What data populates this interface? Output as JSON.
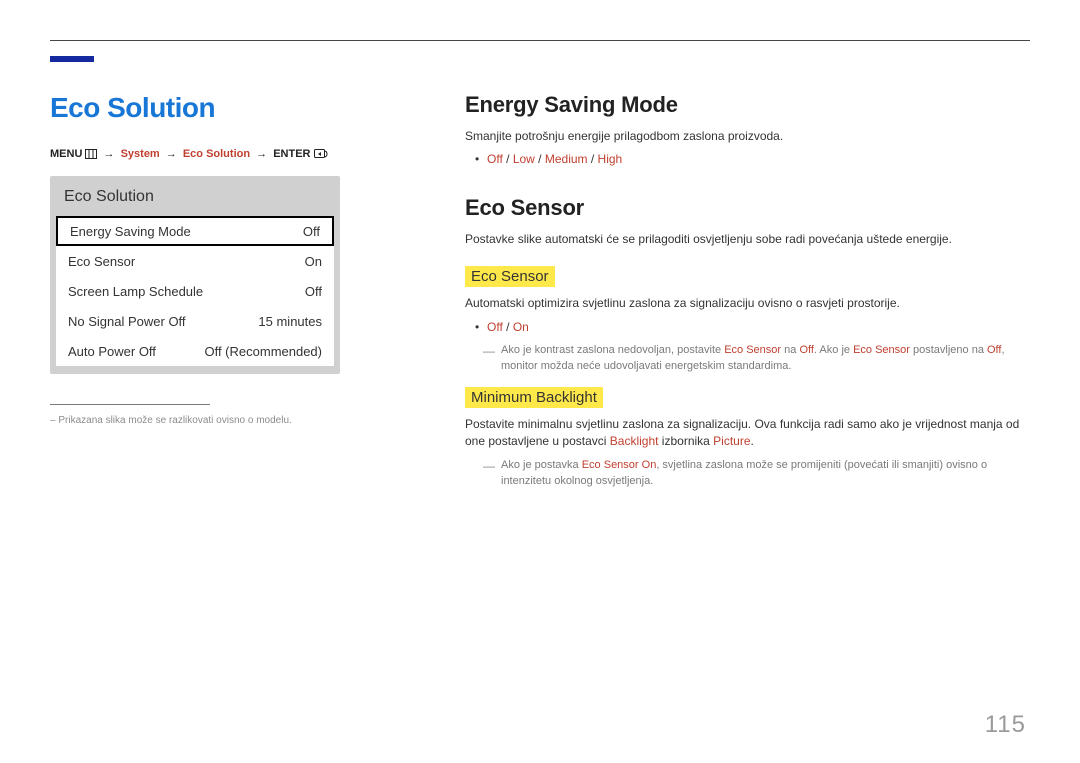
{
  "page_number": "115",
  "left": {
    "title": "Eco Solution",
    "breadcrumb": {
      "prefix": "MENU",
      "system": "System",
      "eco": "Eco Solution",
      "enter": "ENTER"
    },
    "menu": {
      "title": "Eco Solution",
      "rows": [
        {
          "label": "Energy Saving Mode",
          "value": "Off"
        },
        {
          "label": "Eco Sensor",
          "value": "On"
        },
        {
          "label": "Screen Lamp Schedule",
          "value": "Off"
        },
        {
          "label": "No Signal Power Off",
          "value": "15 minutes"
        },
        {
          "label": "Auto Power Off",
          "value": "Off (Recommended)"
        }
      ]
    },
    "note": "Prikazana slika može se razlikovati ovisno o modelu."
  },
  "right": {
    "energy_saving": {
      "heading": "Energy Saving Mode",
      "desc": "Smanjite potrošnju energije prilagodbom zaslona proizvoda.",
      "opts": {
        "off": "Off",
        "low": "Low",
        "medium": "Medium",
        "high": "High"
      }
    },
    "eco_sensor": {
      "heading": "Eco Sensor",
      "desc": "Postavke slike automatski će se prilagoditi osvjetljenju sobe radi povećanja uštede energije.",
      "sub1": {
        "title": "Eco Sensor",
        "desc": "Automatski optimizira svjetlinu zaslona za signalizaciju ovisno o rasvjeti prostorije.",
        "opts": {
          "off": "Off",
          "on": "On"
        },
        "note_pre": "Ako je kontrast zaslona nedovoljan, postavite ",
        "note_eco": "Eco Sensor",
        "note_mid1": " na ",
        "note_off": "Off",
        "note_mid2": ". Ako je ",
        "note_eco2": "Eco Sensor",
        "note_mid3": " postavljeno na ",
        "note_off2": "Off",
        "note_post": ", monitor možda neće udovoljavati energetskim standardima."
      },
      "sub2": {
        "title": "Minimum Backlight",
        "desc_pre": "Postavite minimalnu svjetlinu zaslona za signalizaciju. Ova funkcija radi samo ako je vrijednost manja od one postavljene u postavci ",
        "backlight": "Backlight",
        "desc_mid": " izbornika ",
        "picture": "Picture",
        "desc_post": ".",
        "note_pre": "Ako je postavka ",
        "note_eco_on": "Eco Sensor On",
        "note_post": ", svjetlina zaslona može se promijeniti (povećati ili smanjiti) ovisno o intenzitetu okolnog osvjetljenja."
      }
    }
  }
}
